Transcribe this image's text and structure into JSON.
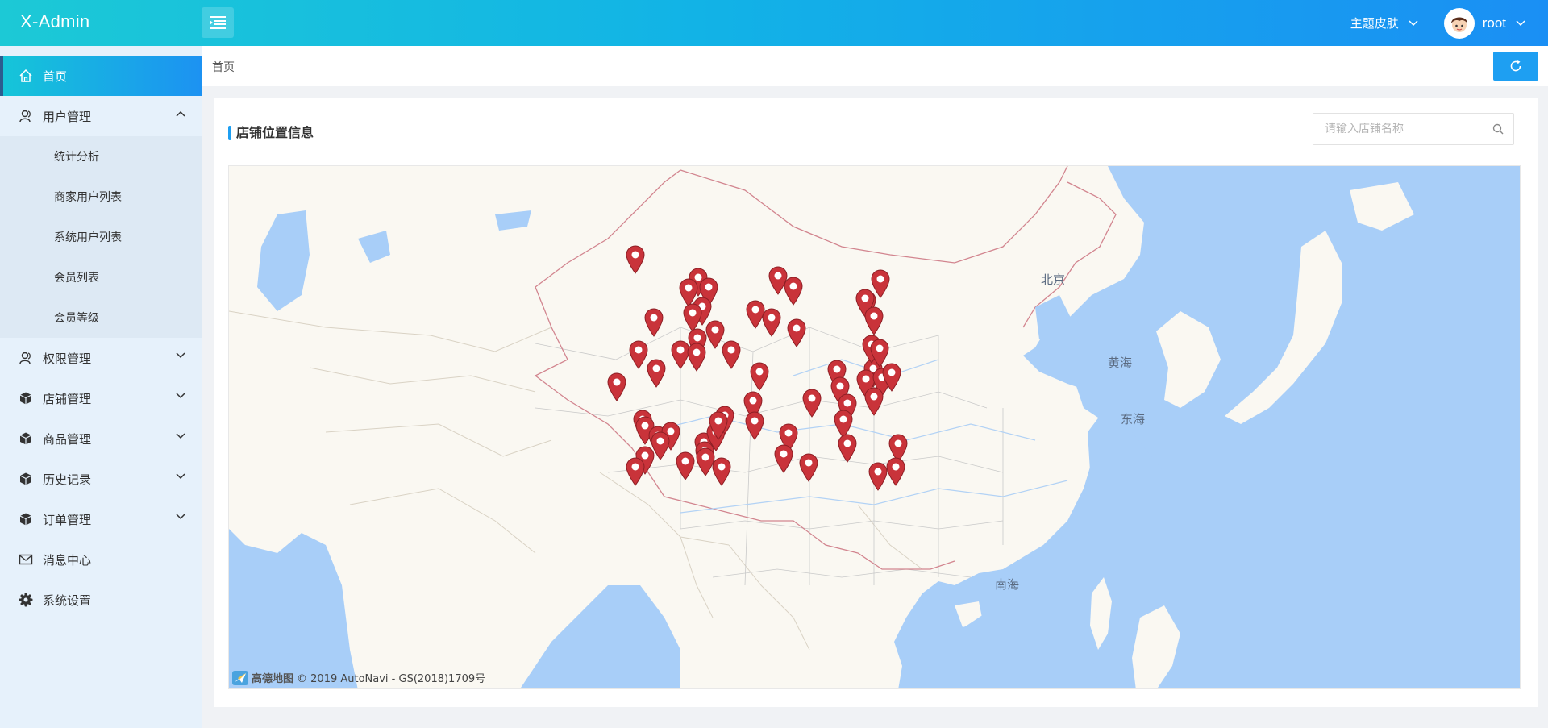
{
  "app": {
    "title": "X-Admin"
  },
  "header": {
    "skin_label": "主题皮肤",
    "user_name": "root"
  },
  "sidebar": {
    "items": [
      {
        "label": "首页",
        "icon": "home-icon",
        "active": true
      },
      {
        "label": "用户管理",
        "icon": "user-icon",
        "expanded": true,
        "children": [
          "统计分析",
          "商家用户列表",
          "系统用户列表",
          "会员列表",
          "会员等级"
        ]
      },
      {
        "label": "权限管理",
        "icon": "user-icon"
      },
      {
        "label": "店铺管理",
        "icon": "cube-icon"
      },
      {
        "label": "商品管理",
        "icon": "cube-icon"
      },
      {
        "label": "历史记录",
        "icon": "cube-icon"
      },
      {
        "label": "订单管理",
        "icon": "cube-icon"
      },
      {
        "label": "消息中心",
        "icon": "mail-icon"
      },
      {
        "label": "系统设置",
        "icon": "gear-icon"
      }
    ]
  },
  "breadcrumb": {
    "current": "首页"
  },
  "card": {
    "title": "店铺位置信息",
    "search_placeholder": "请输入店铺名称"
  },
  "map": {
    "labels": {
      "yellow_sea": "黄海",
      "east_sea": "东海",
      "south_sea": "南海",
      "beijing": "北京"
    },
    "brand": "高德地图",
    "copyright": "© 2019 AutoNavi - GS(2018)1709号",
    "colors": {
      "land": "#faf8f2",
      "water": "#a8cef8",
      "marker": "#c9333a"
    }
  }
}
